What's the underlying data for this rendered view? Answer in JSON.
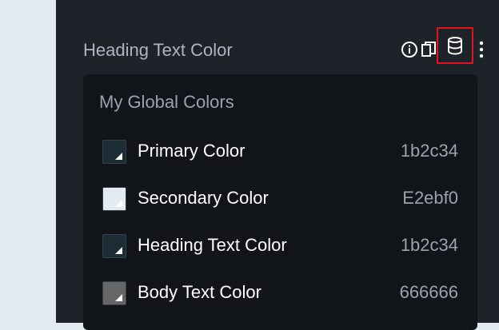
{
  "control": {
    "title": "Heading Text Color"
  },
  "icons": {
    "info": "info-icon",
    "copy": "copy-icon",
    "globals": "database-icon",
    "more": "more-vertical-icon"
  },
  "highlight_color": "#e0121b",
  "global_colors": {
    "title": "My Global Colors",
    "items": [
      {
        "label": "Primary Color",
        "value": "1b2c34",
        "swatch": "#1b2c34"
      },
      {
        "label": "Secondary Color",
        "value": "E2ebf0",
        "swatch": "#e2ebf0"
      },
      {
        "label": "Heading Text Color",
        "value": "1b2c34",
        "swatch": "#1b2c34"
      },
      {
        "label": "Body Text Color",
        "value": "666666",
        "swatch": "#666666"
      }
    ]
  }
}
